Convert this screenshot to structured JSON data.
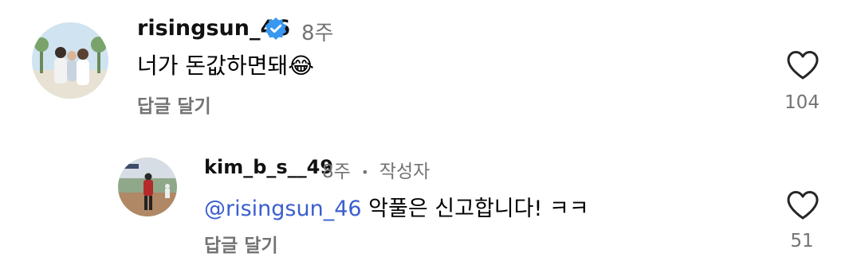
{
  "comments": [
    {
      "username": "risingsun_46",
      "verified": true,
      "time": "8주",
      "text": "너가 돈값하면돼",
      "emoji": "😂",
      "reply_label": "답글 달기",
      "likes": "104"
    },
    {
      "username": "kim_b_s__49",
      "verified": false,
      "time": "8주",
      "separator": "•",
      "author_tag": "작성자",
      "mention": "@risingsun_46",
      "text": "악풀은 신고합니다! ㅋㅋ",
      "reply_label": "답글 달기",
      "likes": "51"
    }
  ],
  "colors": {
    "secondary_text": "#737373",
    "mention": "#3b5ecf",
    "verified_badge": "#3897f0"
  }
}
